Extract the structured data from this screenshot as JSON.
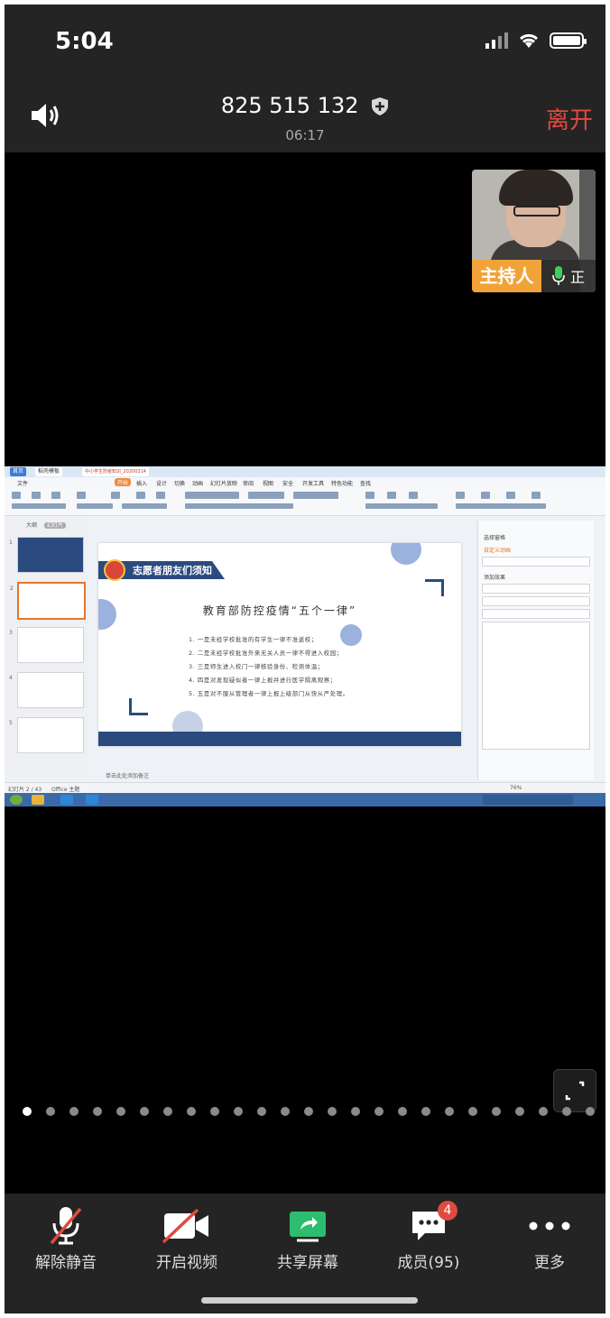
{
  "status_bar": {
    "time": "5:04"
  },
  "header": {
    "meeting_id": "825 515 132",
    "duration": "06:17",
    "leave_label": "离开"
  },
  "host_tile": {
    "role_label": "主持人",
    "name_partial": "正"
  },
  "shared_screen": {
    "window": {
      "tab1": "首页",
      "tab2": "稻壳模板",
      "tab3": "中小学生防疫知识_20200314"
    },
    "menu": [
      "文件",
      "开始",
      "插入",
      "设计",
      "切换",
      "动画",
      "幻灯片放映",
      "审阅",
      "视图",
      "安全",
      "开发工具",
      "特色功能",
      "查找"
    ],
    "thumb_panel": {
      "tab_outline": "大纲",
      "tab_slides": "幻灯片"
    },
    "thumb_numbers": [
      "1",
      "2",
      "3",
      "4",
      "5"
    ],
    "slide": {
      "banner_title": "志愿者朋友们须知",
      "heading": "教育部防控疫情“五个一律”",
      "items": [
        "1. 一是未经学校批准的有学生一律不准返校；",
        "2. 二是未经学校批准外来无关人员一律不得进入校园；",
        "3. 三是师生进入校门一律核验身份、检测体温；",
        "4. 四是对发现疑似者一律上报并进行医学隔离观察；",
        "5. 五是对不服从管理者一律上报上级部门从快从严处理。"
      ]
    },
    "notes_label": "单击此处添加备注",
    "right_panel": {
      "title": "自定义动画",
      "label_select": "选择窗格",
      "label_add": "添加效果"
    },
    "status": {
      "slide_count": "幻灯片 2 / 43",
      "theme": "Office 主题",
      "zoom": "76%"
    }
  },
  "page_dots": {
    "count": 25,
    "active_index": 0
  },
  "toolbar": {
    "unmute": "解除静音",
    "start_video": "开启视频",
    "share_screen": "共享屏幕",
    "members": "成员(95)",
    "members_badge": "4",
    "more": "更多"
  },
  "colors": {
    "leave": "#e14a3f",
    "host_label": "#f1a339",
    "share_green": "#2dbd6e",
    "mic_green": "#3fcf5c",
    "badge": "#e14a3f"
  }
}
